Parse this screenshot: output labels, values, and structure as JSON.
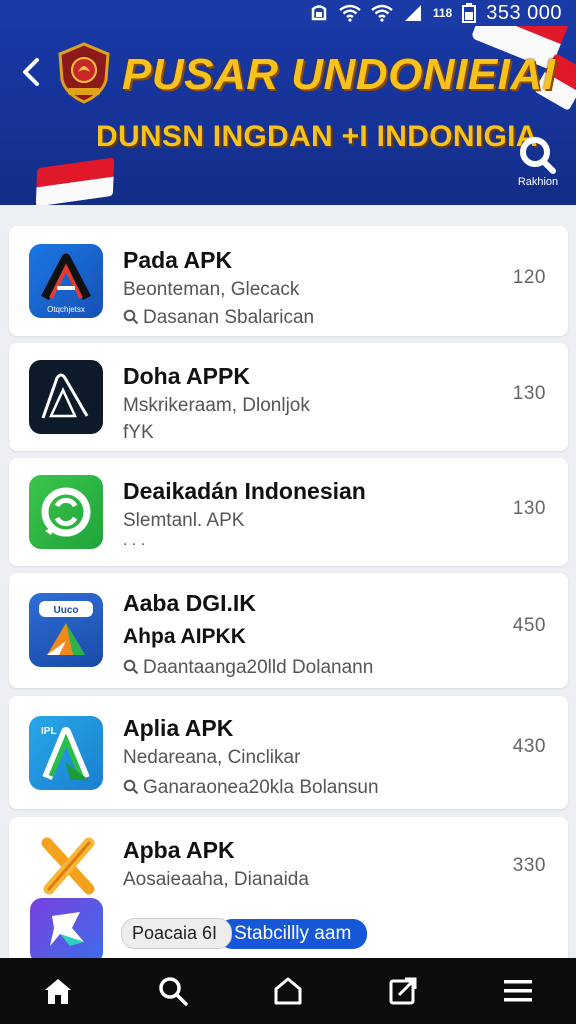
{
  "status_bar": {
    "network_label": "118",
    "time": "353 000"
  },
  "header": {
    "title": "PUSAR UNDONIEIAI",
    "subtitle": "DUNSN INGDAN +I INDONIGIA",
    "search_label": "Rakhion",
    "colors": {
      "background": "#1839a8",
      "title": "#f7c21b",
      "flag_red": "#e1172a"
    }
  },
  "apps": [
    {
      "name": "Pada APK",
      "line1": "Beonteman, Glecack",
      "line2": "Dasanan Sbalarican",
      "line2_has_search_icon": true,
      "count": "120",
      "icon": "a-logo-icon",
      "icon_caption": "Otqchjetsx"
    },
    {
      "name": "Doha APPK",
      "line1": "Mskrikeraam, Dlonljok",
      "line2": "fYK",
      "line2_has_search_icon": false,
      "count": "130",
      "icon": "a-outline-logo-icon"
    },
    {
      "name": "Deaikadán Indonesian",
      "line1": "Slemtanl. APK",
      "line2": ". . .",
      "line2_has_search_icon": false,
      "count": "130",
      "icon": "refresh-chat-icon"
    },
    {
      "name": "Aaba DGI.IK",
      "line1": "Ahpa AIPKK",
      "line2": "Daantaanga20lld Dolanann",
      "line2_has_search_icon": true,
      "count": "450",
      "icon": "triangle-app-icon",
      "icon_caption": "Uuco"
    },
    {
      "name": "Aplia APK",
      "line1": "Nedareana, Cinclikar",
      "line2": "Ganaraonea20kla Bolansun",
      "line2_has_search_icon": true,
      "count": "430",
      "icon": "a-green-logo-icon",
      "icon_caption": "IPL"
    },
    {
      "name": "Apba APK",
      "line1": "Aosaieaaha, Dianaida",
      "line2": "",
      "line2_has_search_icon": false,
      "count": "330",
      "icon": "x-logo-icon"
    }
  ],
  "extra_icon": "pin-app-icon",
  "tags": {
    "grey": "Poacaia 6I",
    "blue": "Stabcillly aam"
  },
  "bottom_nav": [
    "home-icon",
    "search-icon",
    "house-outline-icon",
    "share-box-icon",
    "menu-icon"
  ]
}
